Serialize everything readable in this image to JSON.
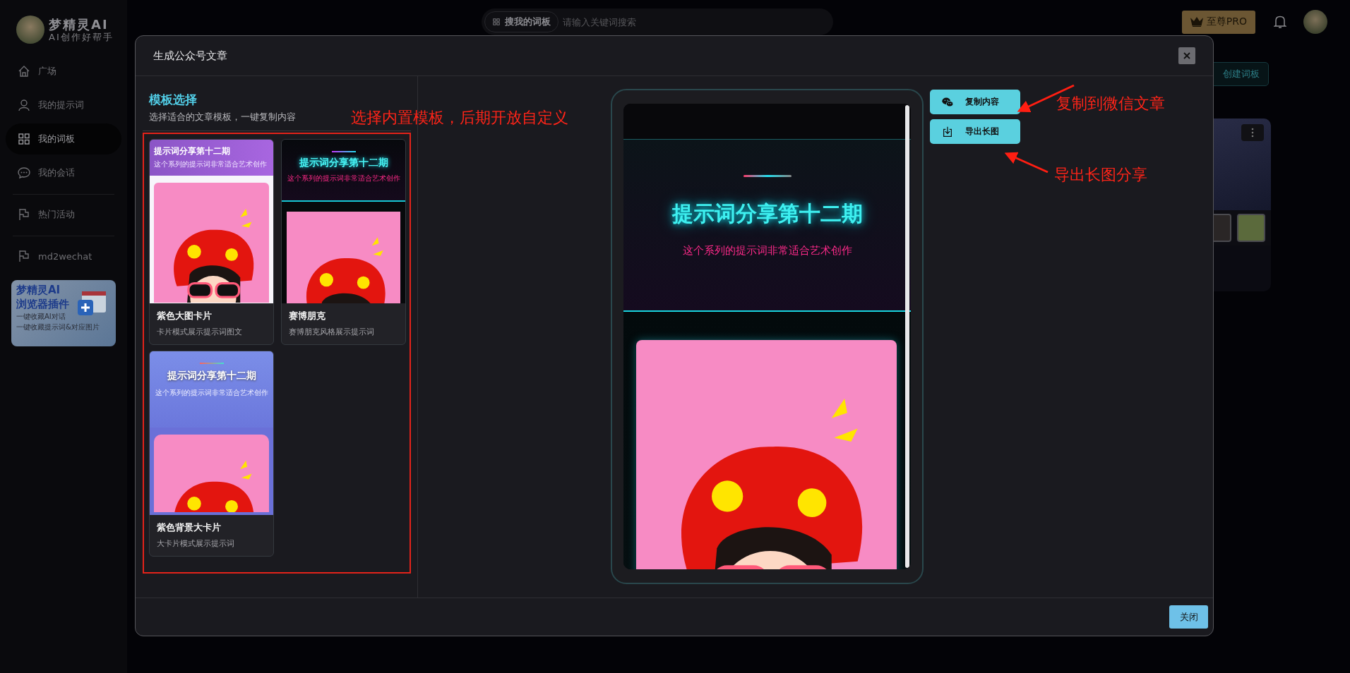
{
  "app": {
    "logo_title": "梦精灵AI",
    "logo_subtitle": "AI创作好帮手"
  },
  "sidebar": {
    "groups": [
      {
        "items": [
          {
            "label": "广场",
            "kind": "home",
            "selected": false
          },
          {
            "label": "我的提示词",
            "kind": "user",
            "selected": false
          },
          {
            "label": "我的词板",
            "kind": "grid",
            "selected": true
          },
          {
            "label": "我的会话",
            "kind": "chat",
            "selected": false
          }
        ]
      },
      {
        "items": [
          {
            "label": "热门活动",
            "kind": "flag",
            "selected": false
          }
        ]
      },
      {
        "items": [
          {
            "label": "md2wechat",
            "kind": "flag",
            "selected": false
          }
        ]
      }
    ],
    "promo": {
      "title": "梦精灵AI",
      "subtitle": "浏览器插件",
      "lines": [
        "一键收藏AI对话",
        "一键收藏提示词&对应图片"
      ]
    }
  },
  "topbar": {
    "search": {
      "scope": "搜我的词板",
      "placeholder": "请输入关键词搜索"
    },
    "pro_button": "至尊PRO"
  },
  "background": {
    "create_button": "创建词板"
  },
  "modal": {
    "title": "生成公众号文章",
    "template_panel": {
      "title": "模板选择",
      "subtitle": "选择适合的文章模板，一键复制内容",
      "templates": [
        {
          "kind": "card",
          "name": "紫色大图卡片",
          "description": "卡片模式展示提示词图文",
          "preview_title": "提示词分享第十二期",
          "preview_subtitle": "这个系列的提示词非常适合艺术创作"
        },
        {
          "kind": "neon",
          "name": "赛博朋克",
          "description": "赛博朋克风格展示提示词",
          "preview_title": "提示词分享第十二期",
          "preview_subtitle": "这个系列的提示词非常适合艺术创作"
        },
        {
          "kind": "banner",
          "name": "紫色背景大卡片",
          "description": "大卡片模式展示提示词",
          "preview_title": "提示词分享第十二期",
          "preview_subtitle": "这个系列的提示词非常适合艺术创作"
        }
      ]
    },
    "preview": {
      "title": "提示词分享第十二期",
      "subtitle": "这个系列的提示词非常适合艺术创作"
    },
    "actions": [
      {
        "label": "复制内容",
        "kind": "wechat"
      },
      {
        "label": "导出长图",
        "kind": "download"
      }
    ],
    "close_button": "关闭"
  },
  "annotations": [
    {
      "text": "选择内置模板，后期开放自定义"
    },
    {
      "text": "复制到微信文章"
    },
    {
      "text": "导出长图分享"
    }
  ]
}
